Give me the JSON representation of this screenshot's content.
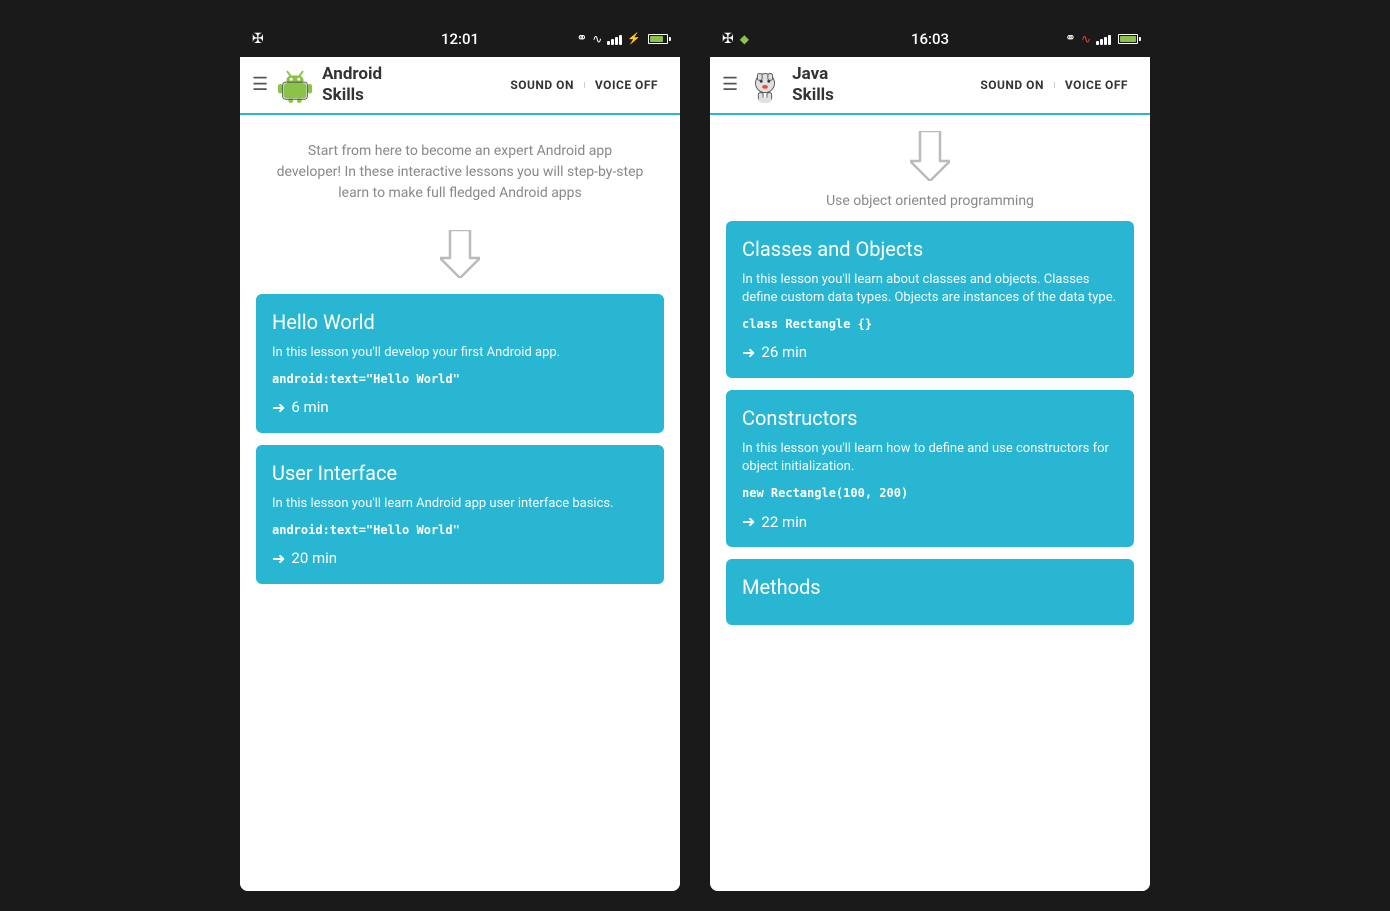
{
  "phone1": {
    "status": {
      "time": "12:01",
      "left_icons": [
        "usb"
      ]
    },
    "appbar": {
      "title": "Android\nSkills",
      "sound_btn": "SOUND ON",
      "voice_btn": "VOICE OFF"
    },
    "intro": "Start from here to become an expert Android app developer! In these interactive lessons you will step-by-step learn to make full fledged Android apps",
    "lessons": [
      {
        "title": "Hello World",
        "desc": "In this lesson you'll develop your first Android app.",
        "code": "android:text=\"Hello World\"",
        "duration": "6 min"
      },
      {
        "title": "User Interface",
        "desc": "In this lesson you'll learn Android app user interface basics.",
        "code": "android:text=\"Hello World\"",
        "duration": "20 min"
      }
    ]
  },
  "phone2": {
    "status": {
      "time": "16:03",
      "left_icons": [
        "usb"
      ]
    },
    "appbar": {
      "title": "Java\nSkills",
      "sound_btn": "SOUND ON",
      "voice_btn": "VOICE OFF"
    },
    "section_label": "Use object oriented programming",
    "lessons": [
      {
        "title": "Classes and Objects",
        "desc": "In this lesson you'll learn about classes and objects. Classes define custom data types. Objects are instances of the data type.",
        "code": "class Rectangle {}",
        "duration": "26 min"
      },
      {
        "title": "Constructors",
        "desc": "In this lesson you'll learn how to define and use constructors for object initialization.",
        "code": "new Rectangle(100, 200)",
        "duration": "22 min"
      },
      {
        "title": "Methods",
        "desc": "",
        "code": "",
        "duration": ""
      }
    ]
  },
  "icons": {
    "arrow_down": "⬇",
    "duration_arrow": "➜",
    "sound_on": "SOUND ON",
    "voice_off": "VOICE OFF"
  }
}
